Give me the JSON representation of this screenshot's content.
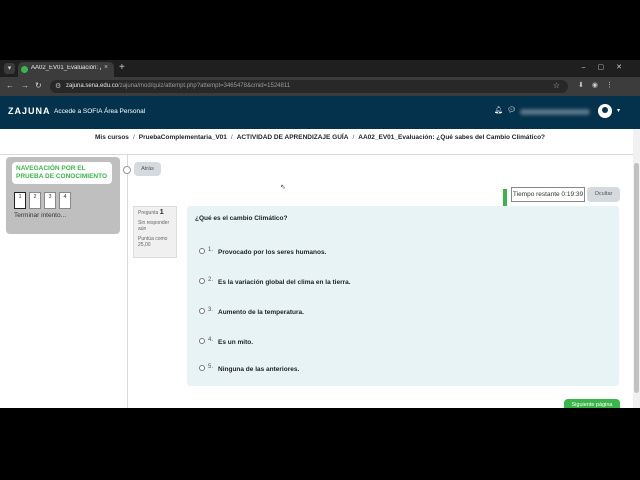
{
  "browser": {
    "tab_title": "AA02_EV01_Evaluación: ¿Qué s",
    "new_tab": "+",
    "url_host": "zajuna.sena.edu.co",
    "url_path": "/zajuna/mod/quiz/attempt.php?attempt=3465478&cmid=1524811"
  },
  "header": {
    "logo": "ZAJUNA",
    "nav": [
      "Accede a SOFIA",
      "Área Personal"
    ]
  },
  "breadcrumb": [
    "Mis cursos",
    "PruebaComplementaria_V01",
    "ACTIVIDAD DE APRENDIZAJE GUÍA",
    "AA02_EV01_Evaluación: ¿Qué sabes del Cambio Climático?"
  ],
  "quiz_nav": {
    "title": "NAVEGACIÓN POR EL PRUEBA DE CONOCIMIENTO",
    "questions": [
      "1",
      "2",
      "3",
      "4"
    ],
    "finish": "Terminar intento..."
  },
  "back_label": "Atrás",
  "timer": {
    "label": "Tiempo restante 0:19:39",
    "hide": "Ocultar"
  },
  "question_info": {
    "label": "Pregunta",
    "number": "1",
    "status": "Sin responder aún",
    "points": "Puntúa como 25,00"
  },
  "question": {
    "text": "¿Qué es el cambio Climático?",
    "options": [
      {
        "num": "1.",
        "text": "Provocado por los seres humanos."
      },
      {
        "num": "2.",
        "text": "Es la variación global del clima en la tierra."
      },
      {
        "num": "3.",
        "text": "Aumento de la temperatura."
      },
      {
        "num": "4.",
        "text": "Es un mito."
      },
      {
        "num": "5.",
        "text": "Ninguna de las anteriores."
      }
    ]
  },
  "next_label": "Siguiente página",
  "colors": {
    "header_bg": "#04324d",
    "accent_green": "#39b54a",
    "question_bg": "#e7f3f5"
  }
}
